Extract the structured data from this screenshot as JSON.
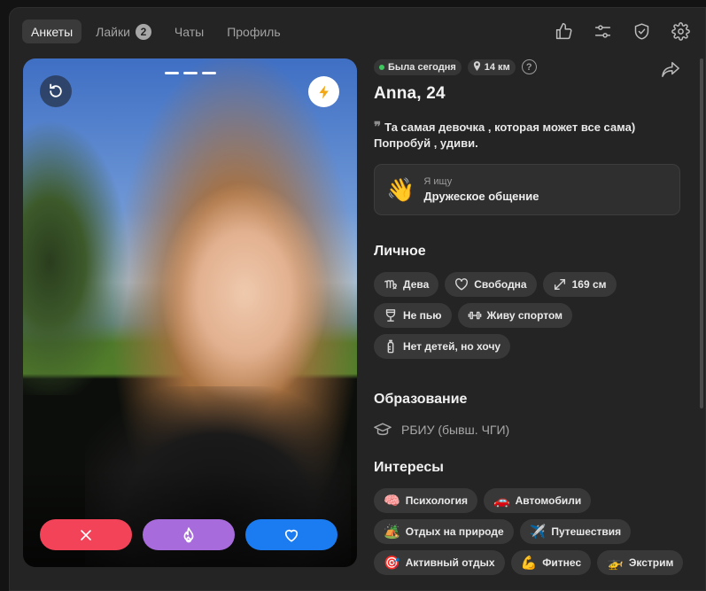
{
  "nav": {
    "tabs": [
      {
        "label": "Анкеты",
        "active": true
      },
      {
        "label": "Лайки",
        "badge": "2"
      },
      {
        "label": "Чаты"
      },
      {
        "label": "Профиль"
      }
    ],
    "icons": [
      "thumbs-up-icon",
      "sliders-icon",
      "shield-check-icon",
      "gear-icon"
    ]
  },
  "photo": {
    "photo_count": 3,
    "photo_index": 1
  },
  "profile": {
    "status": "Была сегодня",
    "distance": "14 км",
    "help_symbol": "?",
    "name": "Anna, 24",
    "bio": "Та самая девочка , которая может все сама) Попробуй , удиви.",
    "seeking_label": "Я ищу",
    "seeking_value": "Дружеское общение",
    "seeking_emoji": "👋"
  },
  "personal": {
    "title": "Личное",
    "chips": [
      {
        "icon": "virgo-icon",
        "label": "Дева"
      },
      {
        "icon": "heart-outline-icon",
        "label": "Свободна"
      },
      {
        "icon": "height-arrows-icon",
        "label": "169 см"
      },
      {
        "icon": "wine-glass-icon",
        "label": "Не пью"
      },
      {
        "icon": "dumbbell-icon",
        "label": "Живу спортом"
      },
      {
        "icon": "baby-bottle-icon",
        "label": "Нет детей, но хочу"
      }
    ]
  },
  "education": {
    "title": "Образование",
    "value": "РБИУ (бывш. ЧГИ)"
  },
  "interests": {
    "title": "Интересы",
    "chips": [
      {
        "emoji": "🧠",
        "label": "Психология"
      },
      {
        "emoji": "🚗",
        "label": "Автомобили"
      },
      {
        "emoji": "🏕️",
        "label": "Отдых на природе"
      },
      {
        "emoji": "✈️",
        "label": "Путешествия"
      },
      {
        "emoji": "🎯",
        "label": "Активный отдых"
      },
      {
        "emoji": "💪",
        "label": "Фитнес"
      },
      {
        "emoji": "🚁",
        "label": "Экстрим"
      }
    ]
  },
  "colors": {
    "dislike": "#f24359",
    "superlike": "#a86bdb",
    "like": "#1b7cf1",
    "online": "#3ec85e"
  }
}
